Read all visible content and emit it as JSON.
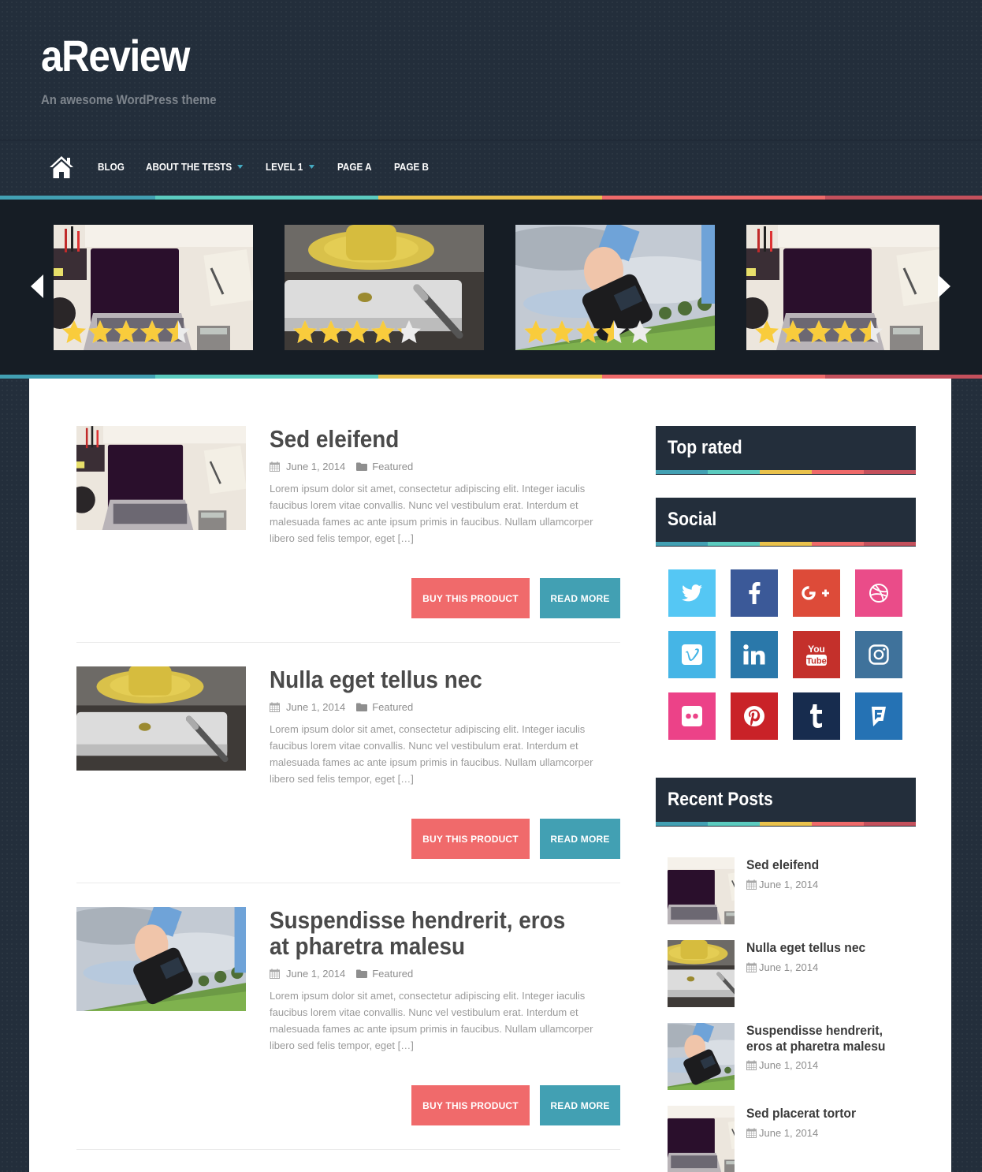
{
  "site": {
    "title": "aReview",
    "description": "An awesome WordPress theme"
  },
  "nav": {
    "home_icon": "home-icon",
    "items": [
      {
        "label": "BLOG",
        "has_dropdown": false
      },
      {
        "label": "ABOUT THE TESTS",
        "has_dropdown": true
      },
      {
        "label": "LEVEL 1",
        "has_dropdown": true
      },
      {
        "label": "PAGE A",
        "has_dropdown": false
      },
      {
        "label": "PAGE B",
        "has_dropdown": false
      }
    ]
  },
  "colors": {
    "stripe": [
      "#42a0b3",
      "#5bcbbf",
      "#eac24c",
      "#ef6a6a",
      "#c4505c"
    ],
    "dark": "#232e3b",
    "slider_bg": "#161d25",
    "buy_button": "#f06a6b",
    "read_button": "#42a0b3",
    "star": "#f9cc3c",
    "star_empty": "#ececec"
  },
  "slider": {
    "prev_icon": "chevron-left-icon",
    "next_icon": "chevron-right-icon",
    "slides": [
      {
        "image": "laptop-desk",
        "rating": 4.5,
        "max_rating": 5
      },
      {
        "image": "tablet-coffee",
        "rating": 4.2,
        "max_rating": 5
      },
      {
        "image": "camera-hand",
        "rating": 3.5,
        "max_rating": 5
      },
      {
        "image": "laptop-desk",
        "rating": 4.5,
        "max_rating": 5
      }
    ]
  },
  "posts": [
    {
      "title": "Sed eleifend",
      "date": "June 1, 2014",
      "category": "Featured",
      "image": "laptop-desk",
      "excerpt": "Lorem ipsum dolor sit amet, consectetur adipiscing elit. Integer iaculis faucibus lorem vitae convallis. Nunc vel vestibulum erat. Interdum et malesuada fames ac ante ipsum primis in faucibus. Nullam ullamcorper libero sed felis tempor, eget […]",
      "buy_label": "BUY THIS PRODUCT",
      "read_label": "READ MORE"
    },
    {
      "title": "Nulla eget tellus nec",
      "date": "June 1, 2014",
      "category": "Featured",
      "image": "tablet-coffee",
      "excerpt": "Lorem ipsum dolor sit amet, consectetur adipiscing elit. Integer iaculis faucibus lorem vitae convallis. Nunc vel vestibulum erat. Interdum et malesuada fames ac ante ipsum primis in faucibus. Nullam ullamcorper libero sed felis tempor, eget […]",
      "buy_label": "BUY THIS PRODUCT",
      "read_label": "READ MORE"
    },
    {
      "title": "Suspendisse hendrerit, eros at pharetra malesu",
      "date": "June 1, 2014",
      "category": "Featured",
      "image": "camera-hand",
      "excerpt": "Lorem ipsum dolor sit amet, consectetur adipiscing elit. Integer iaculis faucibus lorem vitae convallis. Nunc vel vestibulum erat. Interdum et malesuada fames ac ante ipsum primis in faucibus. Nullam ullamcorper libero sed felis tempor, eget […]",
      "buy_label": "BUY THIS PRODUCT",
      "read_label": "READ MORE"
    }
  ],
  "sidebar": {
    "top_rated": {
      "title": "Top rated"
    },
    "social": {
      "title": "Social",
      "networks": [
        {
          "name": "twitter",
          "icon": "twitter-icon",
          "color": "#55c7f4"
        },
        {
          "name": "facebook",
          "icon": "facebook-icon",
          "color": "#3b5998"
        },
        {
          "name": "google-plus",
          "icon": "google-plus-icon",
          "color": "#dd4b39"
        },
        {
          "name": "dribbble",
          "icon": "dribbble-icon",
          "color": "#ea4c89"
        },
        {
          "name": "vimeo",
          "icon": "vimeo-icon",
          "color": "#45b5e6"
        },
        {
          "name": "linkedin",
          "icon": "linkedin-icon",
          "color": "#2a78aa"
        },
        {
          "name": "youtube",
          "icon": "youtube-icon",
          "color": "#c4302b"
        },
        {
          "name": "instagram",
          "icon": "instagram-icon",
          "color": "#3f729b"
        },
        {
          "name": "flickr",
          "icon": "flickr-icon",
          "color": "#ec4288"
        },
        {
          "name": "pinterest",
          "icon": "pinterest-icon",
          "color": "#c92228"
        },
        {
          "name": "tumblr",
          "icon": "tumblr-icon",
          "color": "#172c4e"
        },
        {
          "name": "foursquare",
          "icon": "foursquare-icon",
          "color": "#2572b4"
        }
      ]
    },
    "recent_posts": {
      "title": "Recent Posts",
      "items": [
        {
          "title": "Sed eleifend",
          "date": "June 1, 2014",
          "image": "laptop-desk"
        },
        {
          "title": "Nulla eget tellus nec",
          "date": "June 1, 2014",
          "image": "tablet-coffee"
        },
        {
          "title": "Suspendisse hendrerit, eros at pharetra malesu",
          "date": "June 1, 2014",
          "image": "camera-hand"
        },
        {
          "title": "Sed placerat tortor",
          "date": "June 1, 2014",
          "image": "laptop-desk"
        }
      ]
    }
  }
}
